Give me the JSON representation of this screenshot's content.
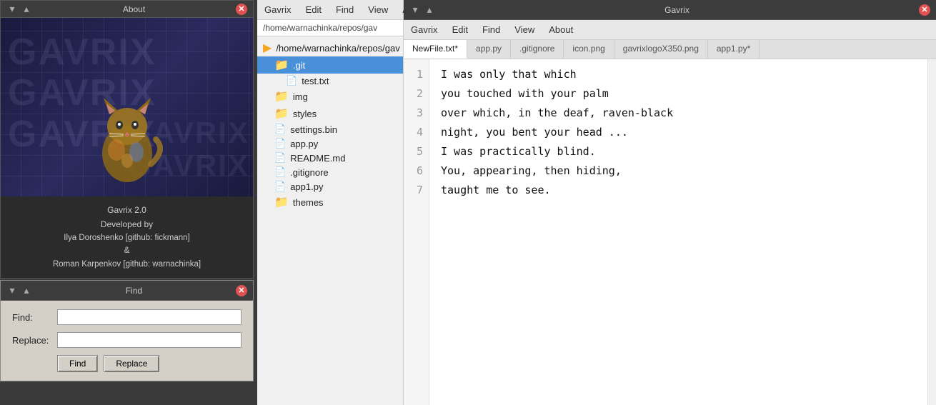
{
  "about": {
    "title": "About",
    "app_name": "Gavrix 2.0",
    "description": "Developed by",
    "authors": "Ilya Doroshenko [github: fickmann]\n&\nRoman Karpenkov [github: warnachinka]",
    "watermark1": "GAVRIX",
    "watermark2": "GAVRIX",
    "controls": {
      "minimize": "▾",
      "maximize": "▴",
      "close": "✕"
    }
  },
  "find": {
    "title": "Find",
    "find_label": "Find:",
    "replace_label": "Replace:",
    "find_value": "",
    "replace_value": "",
    "find_btn": "Find",
    "replace_btn": "Replace",
    "controls": {
      "minimize": "▾",
      "maximize": "▴",
      "close": "✕"
    }
  },
  "file_manager": {
    "menu_items": [
      "Gavrix",
      "Edit",
      "Find",
      "View",
      "About"
    ],
    "path": "/home/warnachinka/repos/gav",
    "items": [
      {
        "name": "/home/warnachinka/repos/gav",
        "type": "folder",
        "indent": 0,
        "expanded": true
      },
      {
        "name": ".git",
        "type": "folder",
        "indent": 1,
        "selected": true
      },
      {
        "name": "test.txt",
        "type": "file",
        "indent": 2
      },
      {
        "name": "img",
        "type": "folder",
        "indent": 1
      },
      {
        "name": "styles",
        "type": "folder",
        "indent": 1
      },
      {
        "name": "settings.bin",
        "type": "file",
        "indent": 1
      },
      {
        "name": "app.py",
        "type": "file",
        "indent": 1
      },
      {
        "name": "README.md",
        "type": "file",
        "indent": 1
      },
      {
        "name": ".gitignore",
        "type": "file",
        "indent": 1
      },
      {
        "name": "app1.py",
        "type": "file",
        "indent": 1
      },
      {
        "name": "themes",
        "type": "folder",
        "indent": 1
      }
    ]
  },
  "editor": {
    "title": "Gavrix",
    "menu_items": [
      "Gavrix",
      "Edit",
      "Find",
      "View",
      "About"
    ],
    "tabs": [
      {
        "label": "NewFile.txt*",
        "active": true
      },
      {
        "label": "app.py",
        "active": false
      },
      {
        "label": ".gitignore",
        "active": false
      },
      {
        "label": "icon.png",
        "active": false
      },
      {
        "label": "gavrixlogoX350.png",
        "active": false
      },
      {
        "label": "app1.py*",
        "active": false
      }
    ],
    "lines": [
      "I was only that which",
      "you touched with your palm",
      "over which, in the deaf, raven-black",
      "night, you bent your head ...",
      "I was practically blind.",
      "You, appearing, then hiding,",
      "taught me to see."
    ],
    "controls": {
      "minimize": "▾",
      "maximize": "▴",
      "close": "✕"
    }
  }
}
